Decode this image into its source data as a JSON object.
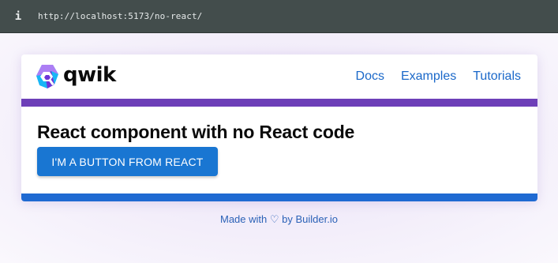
{
  "browser": {
    "info_icon": "info-icon",
    "url": "http://localhost:5173/no-react/"
  },
  "header": {
    "logo_text": "qwik",
    "nav": [
      {
        "label": "Docs"
      },
      {
        "label": "Examples"
      },
      {
        "label": "Tutorials"
      }
    ]
  },
  "main": {
    "title": "React component with no React code",
    "button_label": "I'M A BUTTON FROM REACT"
  },
  "footer": {
    "text_before": "Made with",
    "heart": "♡",
    "text_after": "by Builder.io"
  },
  "colors": {
    "accent_purple": "#6d3fb8",
    "accent_blue": "#1f6ad2",
    "link": "#1a68c9",
    "button": "#1976d2"
  }
}
